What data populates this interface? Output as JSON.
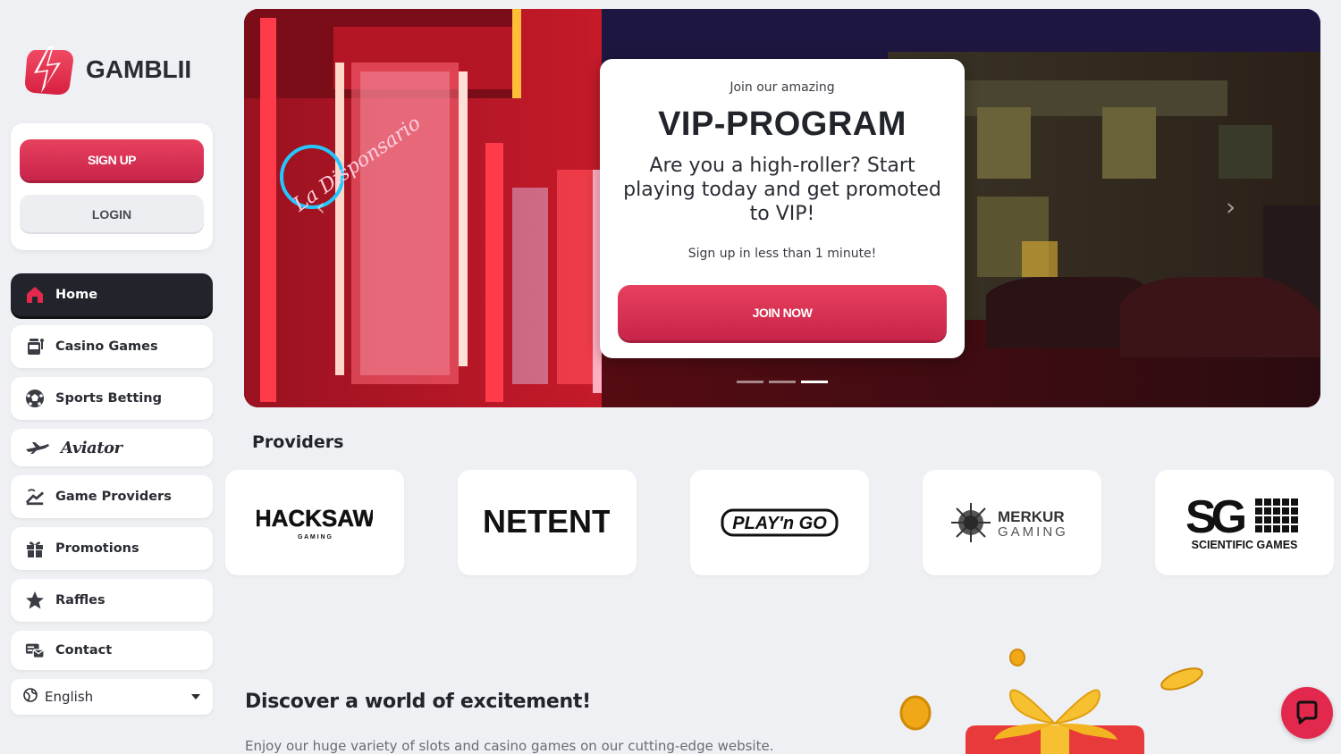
{
  "brand": {
    "name": "GAMBLII",
    "accent": "#e2294d",
    "dark": "#22242b"
  },
  "auth": {
    "signup_label": "SIGN UP",
    "login_label": "LOGIN"
  },
  "nav": [
    {
      "label": "Home",
      "icon": "home-icon",
      "active": true
    },
    {
      "label": "Casino Games",
      "icon": "slot-machine-icon"
    },
    {
      "label": "Sports Betting",
      "icon": "soccer-ball-icon"
    },
    {
      "label": "Aviator",
      "icon": "airplane-icon"
    },
    {
      "label": "Game Providers",
      "icon": "providers-icon"
    },
    {
      "label": "Promotions",
      "icon": "gift-icon"
    },
    {
      "label": "Raffles",
      "icon": "star-icon"
    },
    {
      "label": "Contact",
      "icon": "contact-icon"
    }
  ],
  "language": {
    "selected": "English",
    "icon": "globe-icon"
  },
  "hero": {
    "neon_sign": "La Disponsario",
    "eyebrow": "Join our amazing",
    "title": "VIP-PROGRAM",
    "text": "Are you a high-roller? Start playing today and get promoted to VIP!",
    "subtext": "Sign up in less than 1 minute!",
    "cta_label": "JOIN NOW",
    "slides_total": 3,
    "active_slide": 3
  },
  "providers": {
    "title": "Providers",
    "items": [
      {
        "name": "HACKSAW",
        "sub": "G A M I N G"
      },
      {
        "name": "NETENT"
      },
      {
        "name": "PLAY'n GO"
      },
      {
        "name": "MERKUR",
        "sub": "GAMING"
      },
      {
        "name": "SG",
        "sub": "SCIENTIFIC GAMES"
      }
    ]
  },
  "discover": {
    "title": "Discover a world of excitement!",
    "text": "Enjoy our huge variety of slots and casino games on our cutting-edge website."
  },
  "chat": {
    "icon": "chat-icon"
  }
}
